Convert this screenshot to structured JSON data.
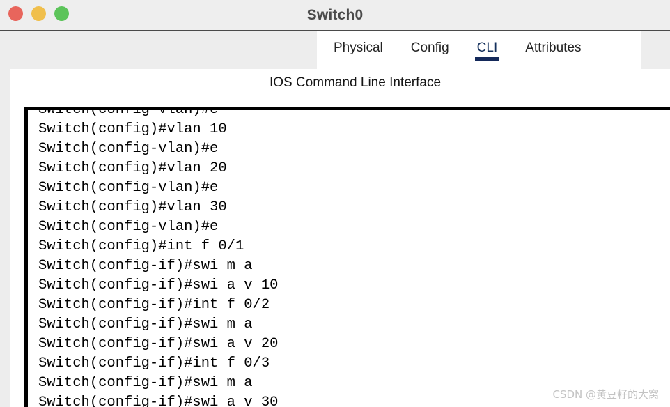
{
  "window": {
    "title": "Switch0",
    "controls": [
      {
        "name": "close",
        "color": "#e8655c"
      },
      {
        "name": "minimize",
        "color": "#f0bf4c"
      },
      {
        "name": "maximize",
        "color": "#5cc45a"
      }
    ]
  },
  "tabs": [
    {
      "label": "Physical",
      "active": false
    },
    {
      "label": "Config",
      "active": false
    },
    {
      "label": "CLI",
      "active": true
    },
    {
      "label": "Attributes",
      "active": false
    }
  ],
  "main": {
    "heading": "IOS Command Line Interface"
  },
  "terminal": {
    "clipped_top_line": "Switch(config-vlan)#e",
    "lines": [
      "Switch(config)#vlan 10",
      "Switch(config-vlan)#e",
      "Switch(config)#vlan 20",
      "Switch(config-vlan)#e",
      "Switch(config)#vlan 30",
      "Switch(config-vlan)#e",
      "Switch(config)#int f 0/1",
      "Switch(config-if)#swi m a",
      "Switch(config-if)#swi a v 10",
      "Switch(config-if)#int f 0/2",
      "Switch(config-if)#swi m a",
      "Switch(config-if)#swi a v 20",
      "Switch(config-if)#int f 0/3",
      "Switch(config-if)#swi m a",
      "Switch(config-if)#swi a v 30"
    ]
  },
  "watermark": {
    "text": "CSDN @黄豆籽的大窝"
  },
  "colors": {
    "accent": "#14295a",
    "titlebar_bg": "#eeeeee",
    "panel_bg": "#ffffff",
    "app_bg": "#ededed"
  }
}
